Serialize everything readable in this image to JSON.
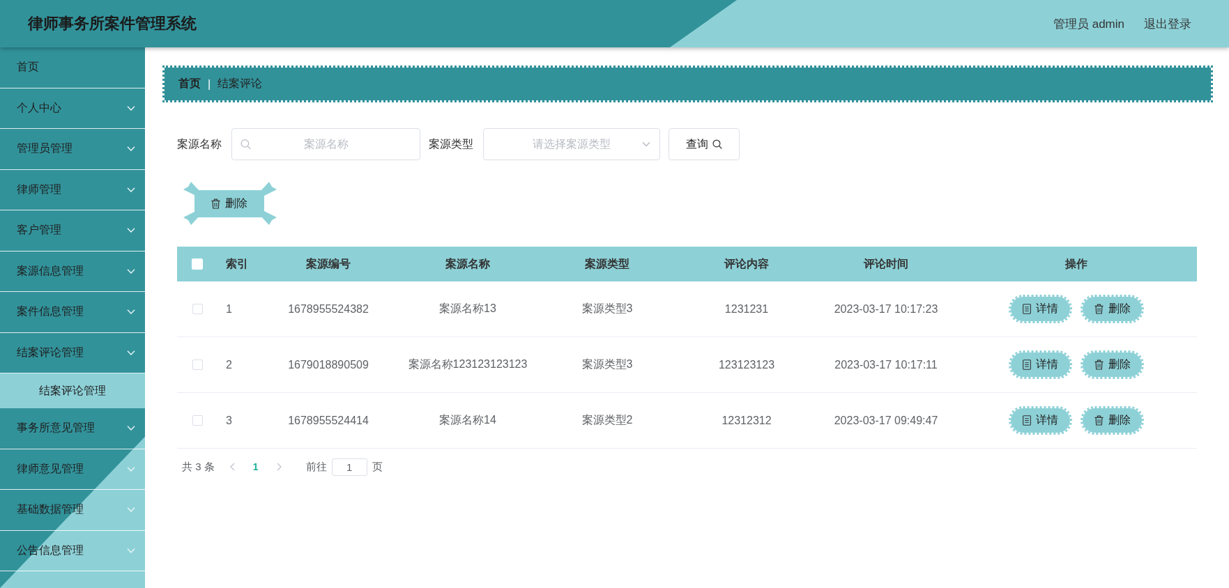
{
  "header": {
    "title": "律师事务所案件管理系统",
    "user": "管理员 admin",
    "logout": "退出登录"
  },
  "sidebar": {
    "items": [
      {
        "label": "首页",
        "kind": "link"
      },
      {
        "label": "个人中心",
        "kind": "submenu"
      },
      {
        "label": "管理员管理",
        "kind": "submenu"
      },
      {
        "label": "律师管理",
        "kind": "submenu"
      },
      {
        "label": "客户管理",
        "kind": "submenu"
      },
      {
        "label": "案源信息管理",
        "kind": "submenu"
      },
      {
        "label": "案件信息管理",
        "kind": "submenu"
      },
      {
        "label": "结案评论管理",
        "kind": "submenu",
        "children": [
          {
            "label": "结案评论管理",
            "selected": true
          }
        ]
      },
      {
        "label": "事务所意见管理",
        "kind": "submenu"
      },
      {
        "label": "律师意见管理",
        "kind": "submenu"
      },
      {
        "label": "基础数据管理",
        "kind": "submenu"
      },
      {
        "label": "公告信息管理",
        "kind": "submenu"
      }
    ]
  },
  "breadcrumb": {
    "items": [
      {
        "label": "首页",
        "kind": "link"
      },
      {
        "label": "结案评论",
        "kind": "current"
      }
    ],
    "separator": "|"
  },
  "search": {
    "fields": [
      {
        "label": "案源名称",
        "kind": "input",
        "placeholder": "案源名称"
      },
      {
        "label": "案源类型",
        "kind": "select",
        "placeholder": "请选择案源类型"
      }
    ],
    "button": "查询"
  },
  "toolbar": {
    "delete_button": "删除"
  },
  "table": {
    "select_all_checked": false,
    "columns": [
      "索引",
      "案源编号",
      "案源名称",
      "案源类型",
      "评论内容",
      "评论时间",
      "操作"
    ],
    "rows": [
      {
        "checked": false,
        "cells": [
          "1",
          "1678955524382",
          "案源名称13",
          "案源类型3",
          "1231231",
          "2023-03-17 10:17:23"
        ],
        "actions": [
          {
            "label": "详情",
            "kind": "detail"
          },
          {
            "label": "删除",
            "kind": "delete"
          }
        ]
      },
      {
        "checked": false,
        "cells": [
          "2",
          "1679018890509",
          "案源名称123123123123",
          "案源类型3",
          "123123123",
          "2023-03-17 10:17:11"
        ],
        "actions": [
          {
            "label": "详情",
            "kind": "detail"
          },
          {
            "label": "删除",
            "kind": "delete"
          }
        ]
      },
      {
        "checked": false,
        "cells": [
          "3",
          "1678955524414",
          "案源名称14",
          "案源类型2",
          "12312312",
          "2023-03-17 09:49:47"
        ],
        "actions": [
          {
            "label": "详情",
            "kind": "detail"
          },
          {
            "label": "删除",
            "kind": "delete"
          }
        ]
      }
    ]
  },
  "pagination": {
    "total": "共 3 条",
    "prev_disabled": true,
    "pages": [
      {
        "label": "1",
        "selected": true
      }
    ],
    "next_disabled": true,
    "goto_label": "前往",
    "goto_value": "1",
    "goto_suffix": "页"
  }
}
